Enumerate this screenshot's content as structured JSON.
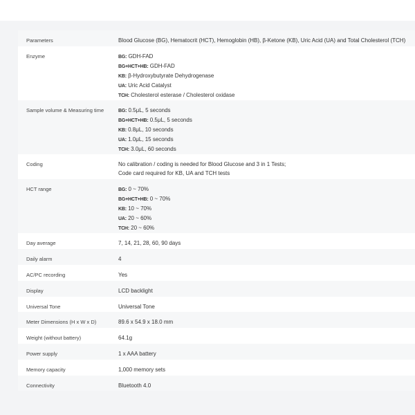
{
  "specs": [
    {
      "label": "Parameters",
      "lines": [
        {
          "key": "",
          "text": "Blood Glucose (BG), Hematocrit (HCT), Hemoglobin (HB), β-Ketone (KB), Uric Acid (UA) and Total Cholesterol (TCH)"
        }
      ]
    },
    {
      "label": "Enzyme",
      "lines": [
        {
          "key": "BG:",
          "text": " GDH-FAD"
        },
        {
          "key": "BG+HCT+HB:",
          "text": " GDH-FAD"
        },
        {
          "key": "KB:",
          "text": " β-Hydroxybutyrate Dehydrogenase"
        },
        {
          "key": "UA:",
          "text": " Uric Acid Catalyst"
        },
        {
          "key": "TCH:",
          "text": " Cholesterol esterase / Cholesterol oxidase"
        }
      ]
    },
    {
      "label": "Sample volume & Measuring time",
      "lines": [
        {
          "key": "BG:",
          "text": " 0.5μL, 5 seconds"
        },
        {
          "key": "BG+HCT+HB:",
          "text": " 0.5μL, 5 seconds"
        },
        {
          "key": "KB:",
          "text": " 0.8μL, 10 seconds"
        },
        {
          "key": "UA:",
          "text": " 1.0μL, 15 seconds"
        },
        {
          "key": "TCH:",
          "text": " 3.0μL, 60 seconds"
        }
      ]
    },
    {
      "label": "Coding",
      "lines": [
        {
          "key": "",
          "text": "No calibration / coding is needed for Blood Glucose and 3 in 1 Tests;"
        },
        {
          "key": "",
          "text": "Code card required for KB, UA and TCH tests"
        }
      ]
    },
    {
      "label": "HCT range",
      "lines": [
        {
          "key": "BG:",
          "text": " 0 ~ 70%"
        },
        {
          "key": "BG+HCT+HB:",
          "text": " 0 ~ 70%"
        },
        {
          "key": "KB:",
          "text": " 10 ~ 70%"
        },
        {
          "key": "UA:",
          "text": " 20 ~ 60%"
        },
        {
          "key": "TCH:",
          "text": " 20 ~ 60%"
        }
      ]
    },
    {
      "label": "Day average",
      "lines": [
        {
          "key": "",
          "text": "7, 14, 21, 28, 60, 90 days"
        }
      ]
    },
    {
      "label": "Daily alarm",
      "lines": [
        {
          "key": "",
          "text": "4"
        }
      ]
    },
    {
      "label": "AC/PC recording",
      "lines": [
        {
          "key": "",
          "text": "Yes"
        }
      ]
    },
    {
      "label": "Display",
      "lines": [
        {
          "key": "",
          "text": "LCD backlight"
        }
      ]
    },
    {
      "label": "Universal Tone",
      "lines": [
        {
          "key": "",
          "text": "Universal Tone"
        }
      ]
    },
    {
      "label": "Meter Dimensions (H x W x D)",
      "lines": [
        {
          "key": "",
          "text": "89.6 x 54.9 x 18.0 mm"
        }
      ]
    },
    {
      "label": "Weight (without battery)",
      "lines": [
        {
          "key": "",
          "text": "64.1g"
        }
      ]
    },
    {
      "label": "Power supply",
      "lines": [
        {
          "key": "",
          "text": "1 x AAA battery"
        }
      ]
    },
    {
      "label": "Memory capacity",
      "lines": [
        {
          "key": "",
          "text": "1,000 memory sets"
        }
      ]
    },
    {
      "label": "Connectivity",
      "lines": [
        {
          "key": "",
          "text": "Bluetooth 4.0"
        }
      ]
    }
  ]
}
